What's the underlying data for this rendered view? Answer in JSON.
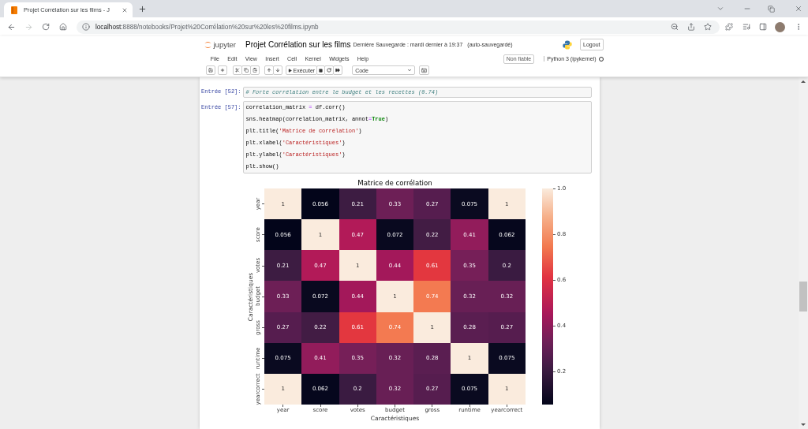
{
  "browser": {
    "tab": {
      "title": "Projet Corrélation sur les films - J",
      "selected": true
    },
    "nav": {
      "back_enabled": true,
      "forward_enabled": false
    },
    "address": {
      "host": "localhost",
      "rest": ":8888/notebooks/Projet%20Corrélation%20sur%20les%20films.ipynb"
    }
  },
  "header": {
    "logo_text": "jupyter",
    "title": "Projet Corrélation sur les films",
    "checkpoint": "Dernière Sauvegarde : mardi dernier à 19:37",
    "autosave": "(auto-sauvegardé)",
    "logout": "Logout"
  },
  "menu": [
    "File",
    "Edit",
    "View",
    "Insert",
    "Cell",
    "Kernel",
    "Widgets",
    "Help"
  ],
  "trust": "Non fiable",
  "kernel": {
    "name": "Python 3 (ipykernel)",
    "busy": false
  },
  "toolbar": {
    "run": "Exécuter",
    "cell_type": "Code"
  },
  "cells": [
    {
      "prompt": "Entrée [52]:",
      "lines": [
        [
          {
            "kind": "comment",
            "text": "# Forte corrélation entre le budget et les recettes (0.74)"
          }
        ]
      ]
    },
    {
      "prompt": "Entrée [57]:",
      "lines": [
        [
          {
            "kind": "plain",
            "text": "correlation_matrix "
          },
          {
            "kind": "operator",
            "text": "="
          },
          {
            "kind": "plain",
            "text": " df.corr()"
          }
        ],
        [
          {
            "kind": "plain",
            "text": "sns.heatmap(correlation_matrix, annot"
          },
          {
            "kind": "operator",
            "text": "="
          },
          {
            "kind": "keyword",
            "text": "True"
          },
          {
            "kind": "plain",
            "text": ")"
          }
        ],
        [
          {
            "kind": "plain",
            "text": "plt.title("
          },
          {
            "kind": "string",
            "text": "'Matrice de corrélation'"
          },
          {
            "kind": "plain",
            "text": ")"
          }
        ],
        [
          {
            "kind": "plain",
            "text": "plt.xlabel("
          },
          {
            "kind": "string",
            "text": "'Caractéristiques'"
          },
          {
            "kind": "plain",
            "text": ")"
          }
        ],
        [
          {
            "kind": "plain",
            "text": "plt.ylabel("
          },
          {
            "kind": "string",
            "text": "'Caractéristiques'"
          },
          {
            "kind": "plain",
            "text": ")"
          }
        ],
        [
          {
            "kind": "plain",
            "text": "plt.show()"
          }
        ]
      ],
      "output": {
        "figure": {
          "title": "Matrice de corrélation",
          "ylabel": "Caractéristiques",
          "rows": [
            {
              "label": "year",
              "cells": [
                {
                  "text": "1",
                  "color": "#faebdd"
                },
                {
                  "text": "0.056",
                  "color": "#03051a"
                },
                {
                  "text": "0.21",
                  "color": "#3d1c42"
                },
                {
                  "text": "0.33",
                  "color": "#6d1f56"
                },
                {
                  "text": "0.27",
                  "color": "#561d4f"
                },
                {
                  "text": "0.075",
                  "color": "#0a0a20"
                },
                {
                  "text": "1",
                  "color": "#faebdd"
                }
              ]
            },
            {
              "label": "score",
              "cells": [
                {
                  "text": "0.056",
                  "color": "#03051a"
                },
                {
                  "text": "1",
                  "color": "#faebdd"
                },
                {
                  "text": "0.47",
                  "color": "#b21a58"
                },
                {
                  "text": "0.072",
                  "color": "#09091f"
                },
                {
                  "text": "0.22",
                  "color": "#421c44"
                },
                {
                  "text": "0.41",
                  "color": "#921c5b"
                },
                {
                  "text": "0.062",
                  "color": "#06071d"
                }
              ]
            },
            {
              "label": "votes",
              "cells": [
                {
                  "text": "0.21",
                  "color": "#3d1c42"
                },
                {
                  "text": "0.47",
                  "color": "#b21a58"
                },
                {
                  "text": "1",
                  "color": "#faebdd"
                },
                {
                  "text": "0.44",
                  "color": "#a3185a"
                },
                {
                  "text": "0.61",
                  "color": "#e3373f"
                },
                {
                  "text": "0.35",
                  "color": "#761f58"
                },
                {
                  "text": "0.2",
                  "color": "#3a1b41"
                }
              ]
            },
            {
              "label": "budget",
              "cells": [
                {
                  "text": "0.33",
                  "color": "#6d1f56"
                },
                {
                  "text": "0.072",
                  "color": "#09091f"
                },
                {
                  "text": "0.44",
                  "color": "#a3185a"
                },
                {
                  "text": "1",
                  "color": "#faebdd"
                },
                {
                  "text": "0.74",
                  "color": "#f37a51"
                },
                {
                  "text": "0.32",
                  "color": "#681f55"
                },
                {
                  "text": "0.32",
                  "color": "#681f55"
                }
              ]
            },
            {
              "label": "gross",
              "cells": [
                {
                  "text": "0.27",
                  "color": "#561d4f"
                },
                {
                  "text": "0.22",
                  "color": "#421c44"
                },
                {
                  "text": "0.61",
                  "color": "#e3373f"
                },
                {
                  "text": "0.74",
                  "color": "#f37a51"
                },
                {
                  "text": "1",
                  "color": "#faebdd"
                },
                {
                  "text": "0.28",
                  "color": "#5a1e51"
                },
                {
                  "text": "0.27",
                  "color": "#561d4f"
                }
              ]
            },
            {
              "label": "runtime",
              "cells": [
                {
                  "text": "0.075",
                  "color": "#0a0a20"
                },
                {
                  "text": "0.41",
                  "color": "#921c5b"
                },
                {
                  "text": "0.35",
                  "color": "#761f58"
                },
                {
                  "text": "0.32",
                  "color": "#681f55"
                },
                {
                  "text": "0.28",
                  "color": "#5a1e51"
                },
                {
                  "text": "1",
                  "color": "#faebdd"
                },
                {
                  "text": "0.075",
                  "color": "#0a0a20"
                }
              ]
            },
            {
              "label": "yearcorrect",
              "cells": [
                {
                  "text": "1",
                  "color": "#faebdd"
                },
                {
                  "text": "0.062",
                  "color": "#06071d"
                },
                {
                  "text": "0.2",
                  "color": "#3a1b41"
                },
                {
                  "text": "0.32",
                  "color": "#681f55"
                },
                {
                  "text": "0.27",
                  "color": "#561d4f"
                },
                {
                  "text": "0.075",
                  "color": "#0a0a20"
                },
                {
                  "text": "1",
                  "color": "#faebdd"
                }
              ]
            }
          ],
          "x_labels": [
            "year",
            "score",
            "votes",
            "budget",
            "gross",
            "runtime",
            "yearcorrect"
          ],
          "xlabel": "Caractéristiques",
          "colorbar": {
            "ticks": [
              "1.0",
              "0.8",
              "0.6",
              "0.4",
              "0.2"
            ]
          }
        }
      }
    }
  ]
}
